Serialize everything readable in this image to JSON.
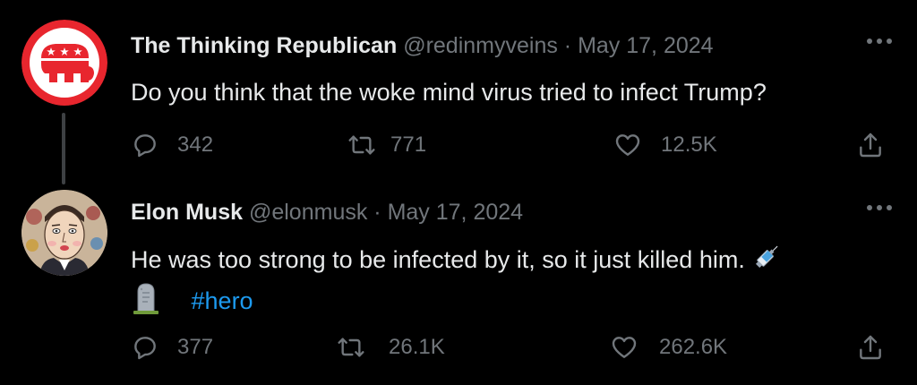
{
  "tweets": [
    {
      "author": "The Thinking Republican",
      "handle": "@redinmyveins",
      "separator": "·",
      "date": "May 17, 2024",
      "text": "Do you think that the woke mind virus tried to infect Trump?",
      "replies": "342",
      "retweets": "771",
      "likes": "12.5K",
      "avatar_icon": "gop-elephant-logo",
      "colors": {
        "avatar_red": "#e8262e"
      }
    },
    {
      "author": "Elon Musk",
      "handle": "@elonmusk",
      "separator": "·",
      "date": "May 17, 2024",
      "text_line1": "He was too strong to be infected by it, so it just killed him.",
      "emoji_1": "syringe-emoji",
      "emoji_2": "headstone-emoji",
      "hashtag": "#hero",
      "replies": "377",
      "retweets": "26.1K",
      "likes": "262.6K",
      "avatar_icon": "elon-musk-cartoon-avatar"
    }
  ],
  "icons": {
    "more": "more-options-icon",
    "reply": "reply-icon",
    "retweet": "retweet-icon",
    "like": "heart-icon",
    "share": "share-icon"
  },
  "colors": {
    "background": "#000000",
    "text_primary": "#e7e9ea",
    "text_secondary": "#71767b",
    "link": "#1d9bf0",
    "thread_line": "#3e4144"
  }
}
